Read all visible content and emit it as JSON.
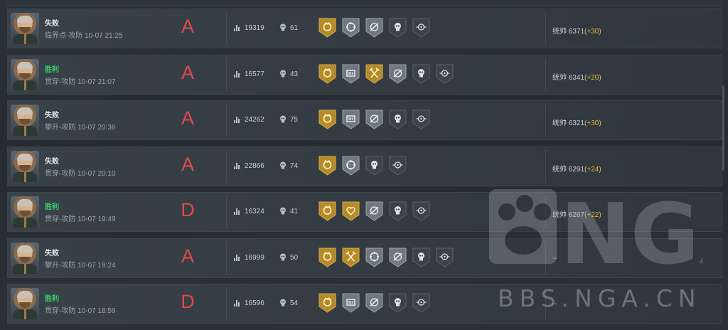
{
  "labels": {
    "rating_prefix": "统帅"
  },
  "matches": [
    {
      "result": "失败",
      "win": false,
      "mode": "临界点-攻防",
      "time": "10-07 21:25",
      "grade": "A",
      "score": "19319",
      "kills": "61",
      "badges": [
        "gold-crown",
        "silver-crosshair",
        "silver-sniper",
        "dark-skull",
        "dark-scope"
      ],
      "rating": "6371",
      "delta": "(+30)"
    },
    {
      "result": "胜利",
      "win": true,
      "mode": "贯穿-攻防",
      "time": "10-07 21:07",
      "grade": "A",
      "score": "16577",
      "kills": "43",
      "badges": [
        "gold-crown",
        "silver-ammo",
        "gold-axe",
        "silver-sniper",
        "dark-skull",
        "dark-scope"
      ],
      "rating": "6341",
      "delta": "(+20)"
    },
    {
      "result": "失败",
      "win": false,
      "mode": "攀升-攻防",
      "time": "10-07 20:36",
      "grade": "A",
      "score": "24262",
      "kills": "75",
      "badges": [
        "gold-crown",
        "silver-ammo",
        "silver-sniper",
        "dark-skull",
        "dark-scope"
      ],
      "rating": "6321",
      "delta": "(+30)"
    },
    {
      "result": "失败",
      "win": false,
      "mode": "贯穿-攻防",
      "time": "10-07 20:10",
      "grade": "A",
      "score": "22866",
      "kills": "74",
      "badges": [
        "gold-crown",
        "silver-crosshair",
        "dark-skull",
        "dark-scope"
      ],
      "rating": "6291",
      "delta": "(+24)"
    },
    {
      "result": "胜利",
      "win": true,
      "mode": "贯穿-攻防",
      "time": "10-07 19:49",
      "grade": "D",
      "score": "16324",
      "kills": "41",
      "badges": [
        "gold-crown",
        "gold-heart",
        "silver-sniper",
        "dark-skull",
        "dark-scope"
      ],
      "rating": "6267",
      "delta": "(+22)"
    },
    {
      "result": "失败",
      "win": false,
      "mode": "攀升-攻防",
      "time": "10-07 19:24",
      "grade": "A",
      "score": "16999",
      "kills": "50",
      "badges": [
        "gold-crown",
        "gold-axe",
        "silver-crosshair",
        "silver-sniper",
        "dark-skull",
        "dark-scope"
      ],
      "rating": "--",
      "delta": ""
    },
    {
      "result": "胜利",
      "win": true,
      "mode": "贯穿-攻防",
      "time": "10-07 18:59",
      "grade": "D",
      "score": "16596",
      "kills": "54",
      "badges": [
        "gold-crown",
        "silver-ammo",
        "silver-sniper",
        "dark-skull",
        "dark-scope"
      ],
      "rating": "--",
      "delta": ""
    }
  ],
  "watermark": {
    "logo": "NGA",
    "site": "BBS.NGA.CN"
  },
  "colors": {
    "win": "#3ccf6b",
    "loss": "#e6e9eb",
    "grade": "#e04a4a",
    "delta": "#e1b84a"
  }
}
